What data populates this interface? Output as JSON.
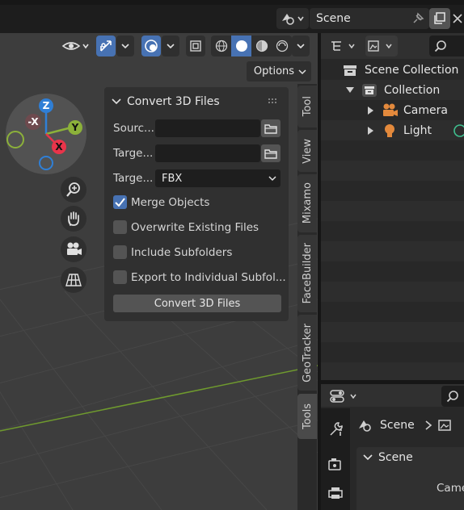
{
  "header": {
    "scene_label": "Scene",
    "options_label": "Options"
  },
  "gizmo": {
    "z": "Z",
    "y": "Y",
    "neg_x": "-X",
    "x": "X"
  },
  "panel": {
    "title": "Convert 3D Files",
    "source_label": "Sourc...",
    "target_label": "Targe...",
    "target_format_label": "Targe...",
    "format_value": "FBX",
    "merge_objects": {
      "label": "Merge Objects",
      "checked": true
    },
    "overwrite": {
      "label": "Overwrite Existing Files",
      "checked": false
    },
    "include_sub": {
      "label": "Include Subfolders",
      "checked": false
    },
    "export_individual": {
      "label": "Export to Individual Subfol...",
      "checked": false
    },
    "convert_button": "Convert 3D Files"
  },
  "tabs": [
    "Tool",
    "View",
    "Mixamo",
    "FaceBuilder",
    "GeoTracker",
    "Tools"
  ],
  "outliner": {
    "scene_collection": "Scene Collection",
    "collection": "Collection",
    "camera": "Camera",
    "light": "Light"
  },
  "properties": {
    "scene_crumb": "Scene",
    "section_title": "Scene",
    "camera_field_label": "Came"
  },
  "colors": {
    "accent_blue": "#4772b3",
    "axis_x": "#e8344a",
    "axis_y": "#8cb13a",
    "axis_z": "#2f7fd6",
    "grid_green": "#6f9a2e"
  }
}
